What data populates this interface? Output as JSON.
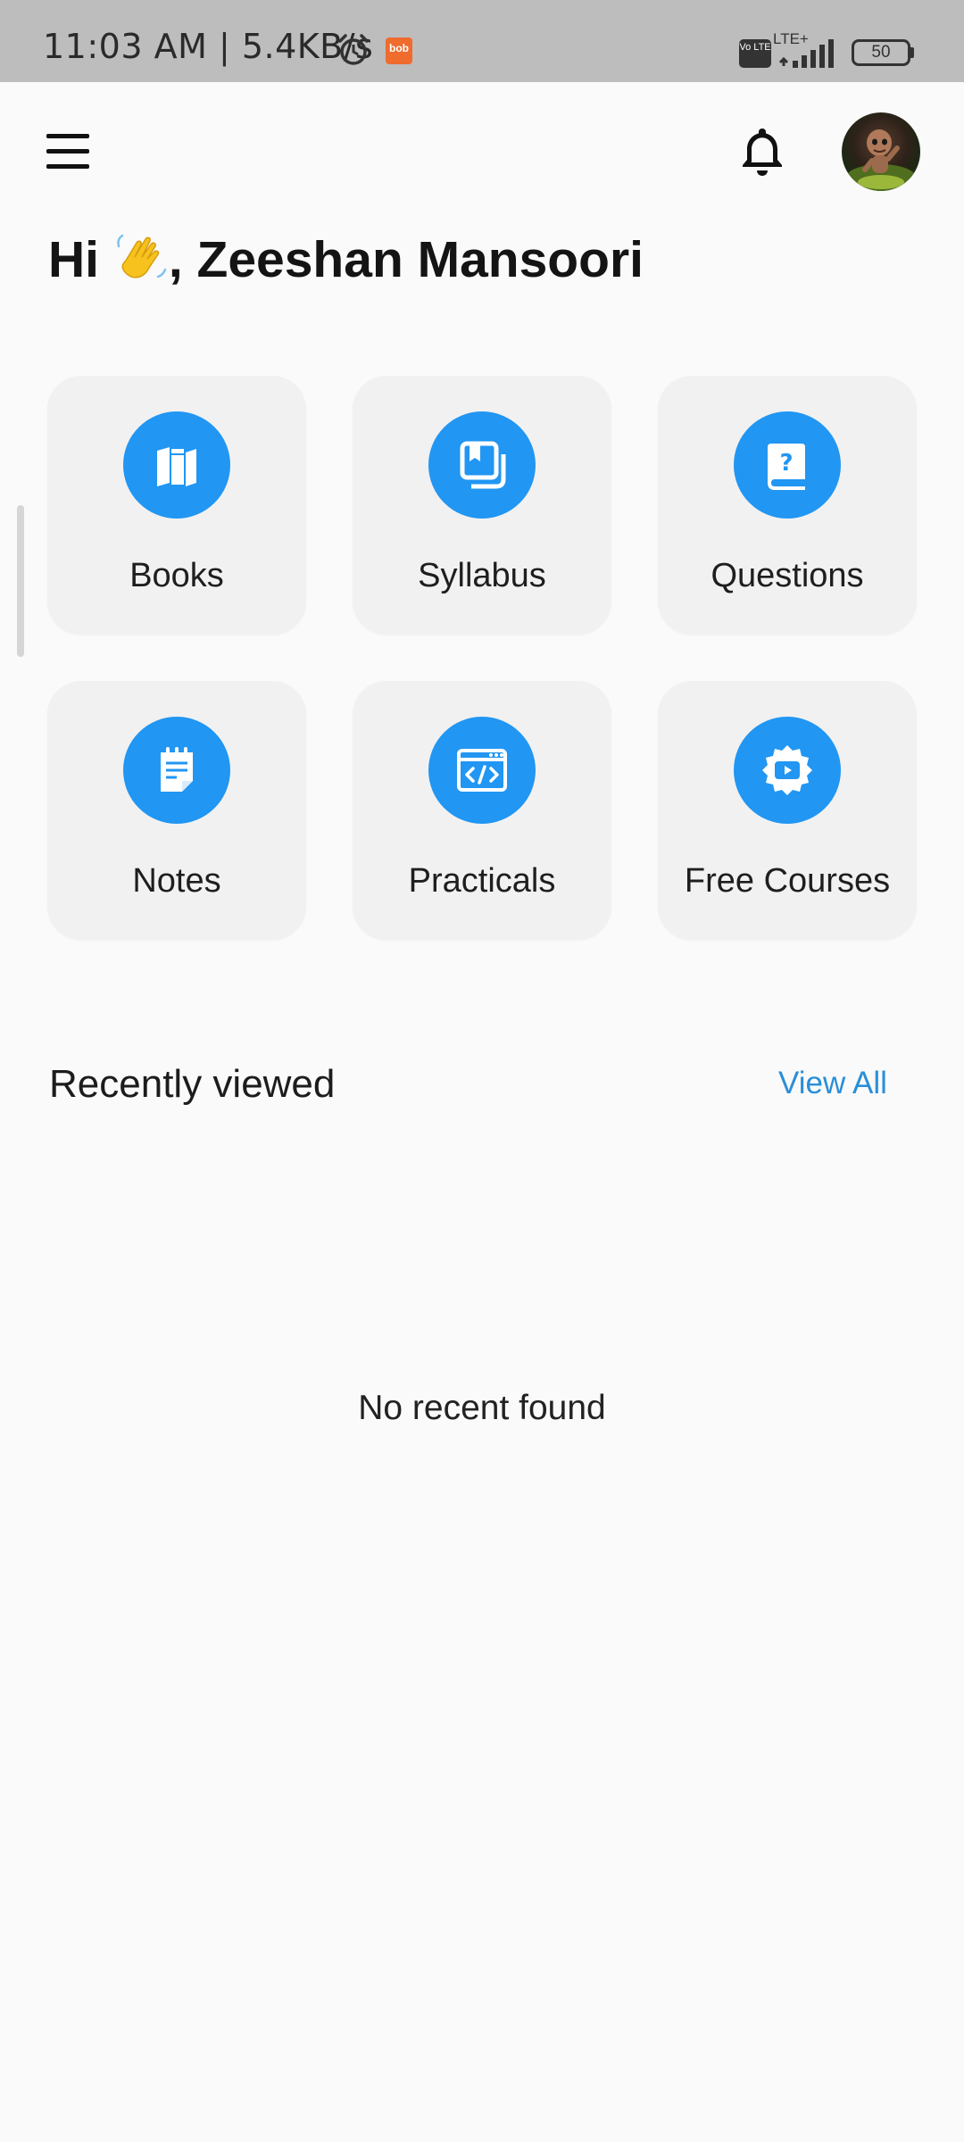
{
  "status_bar": {
    "time": "11:03 AM | 5.4KB/s",
    "app_badge": "bob",
    "volte": "Vo LTE",
    "network": "LTE+",
    "battery": "50"
  },
  "header": {
    "greeting": "Hi 👋, Zeeshan Mansoori",
    "greeting_prefix": "Hi",
    "user_name": ", Zeeshan Mansoori"
  },
  "tiles": [
    {
      "label": "Books",
      "icon": "books-icon"
    },
    {
      "label": "Syllabus",
      "icon": "syllabus-icon"
    },
    {
      "label": "Questions",
      "icon": "question-book-icon"
    },
    {
      "label": "Notes",
      "icon": "notes-icon"
    },
    {
      "label": "Practicals",
      "icon": "code-window-icon"
    },
    {
      "label": "Free Courses",
      "icon": "video-badge-icon"
    }
  ],
  "recent": {
    "title": "Recently viewed",
    "view_all": "View All",
    "empty": "No recent found"
  },
  "colors": {
    "accent": "#2196f3",
    "link": "#2a8fd8",
    "tile_bg": "#f1f1f1",
    "status_bar_bg": "#bdbdbd"
  }
}
